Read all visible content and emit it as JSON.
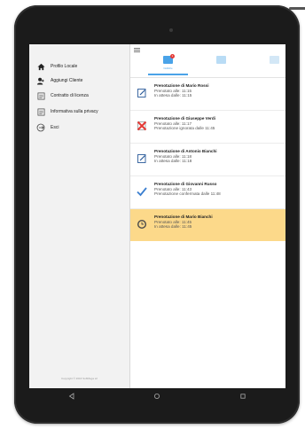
{
  "sidebar": {
    "items": [
      {
        "label": "Profilo Locale",
        "icon": "home-icon"
      },
      {
        "label": "Aggiungi Cliente",
        "icon": "add-user-icon"
      },
      {
        "label": "Contratto di licenza",
        "icon": "document-icon"
      },
      {
        "label": "Informativa sulla privacy",
        "icon": "document-icon"
      },
      {
        "label": "Esci",
        "icon": "logout-icon"
      }
    ],
    "copyright": "Copyright © 2016 SoftMega srl"
  },
  "header": {
    "tabs": [
      {
        "label": "Notifiche",
        "icon": "calendar-icon",
        "active": true,
        "badge": "1"
      },
      {
        "label": "",
        "icon": "briefcase-icon",
        "active": false
      },
      {
        "label": "",
        "icon": "user-icon",
        "active": false
      }
    ]
  },
  "notifications": [
    {
      "title": "Prenotazione di Mario Rossi",
      "line1": "Prenotato alle: 11:15",
      "line2": "In attesa dalle: 11:15",
      "icon": "pencil-edit-icon",
      "highlight": false
    },
    {
      "title": "Prenotazione di Giuseppe Verdi",
      "line1": "Prenotato alle: 11:17",
      "line2": "Prenotazione ignorata dalle 11:45",
      "icon": "cross-icon",
      "highlight": false
    },
    {
      "title": "Prenotazione di Antonio Bianchi",
      "line1": "Prenotato alle: 11:18",
      "line2": "In attesa dalle: 11:18",
      "icon": "pencil-edit-icon",
      "highlight": false
    },
    {
      "title": "Prenotazione di Giovanni Russo",
      "line1": "Prenotato alle: 11:43",
      "line2": "Prenotazione confermata dalle 11:48",
      "icon": "checkmark-icon",
      "highlight": false
    },
    {
      "title": "Prenotazione di Mario Bianchi",
      "line1": "Prenotato alle: 11:45",
      "line2": "In attesa dalle: 11:45",
      "icon": "clock-icon",
      "highlight": true
    }
  ],
  "navbar": {
    "buttons": [
      "back-icon",
      "home-circle-icon",
      "recents-icon"
    ]
  },
  "colors": {
    "accent": "#4aa3e8",
    "highlight": "#fcd98a",
    "error": "#e53935",
    "frame": "#1b1b1b"
  }
}
